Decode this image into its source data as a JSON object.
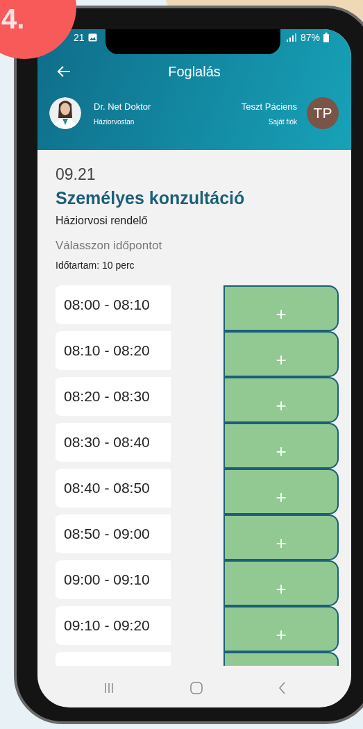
{
  "badge": {
    "label": "4."
  },
  "status_bar": {
    "time": "21",
    "battery": "87%"
  },
  "header": {
    "title": "Foglalás",
    "doctor": {
      "name": "Dr. Net Doktor",
      "specialty": "Háziorvostan"
    },
    "patient": {
      "name": "Teszt Páciens",
      "subtitle": "Saját fiók",
      "initials": "TP"
    }
  },
  "appointment": {
    "date": "09.21",
    "title": "Személyes konzultáció",
    "place": "Háziorvosi rendelő",
    "prompt": "Válasszon időpontot",
    "duration": "Időtartam: 10 perc"
  },
  "slots": [
    {
      "time": "08:00 - 08:10",
      "action": "+"
    },
    {
      "time": "08:10 - 08:20",
      "action": "+"
    },
    {
      "time": "08:20 - 08:30",
      "action": "+"
    },
    {
      "time": "08:30 - 08:40",
      "action": "+"
    },
    {
      "time": "08:40 - 08:50",
      "action": "+"
    },
    {
      "time": "08:50 - 09:00",
      "action": "+"
    },
    {
      "time": "09:00 - 09:10",
      "action": "+"
    },
    {
      "time": "09:10 - 09:20",
      "action": "+"
    }
  ]
}
